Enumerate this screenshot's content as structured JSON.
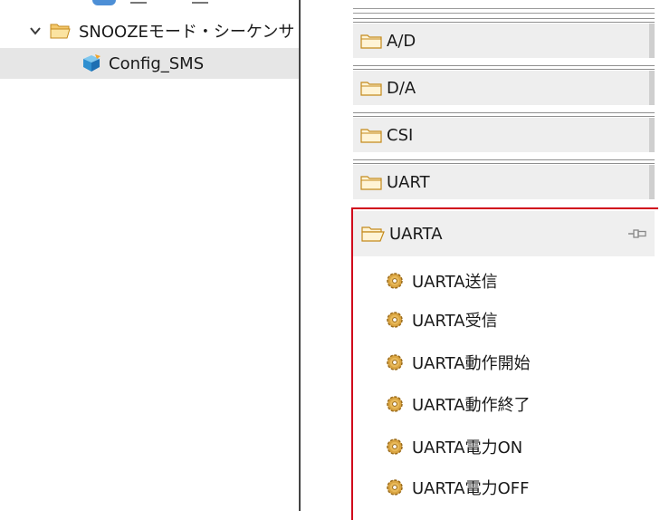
{
  "tree": {
    "parent": {
      "label": "SNOOZEモード・シーケンサ",
      "expanded": true
    },
    "child": {
      "label": "Config_SMS"
    }
  },
  "palette": {
    "drawers": [
      {
        "label": "A/D"
      },
      {
        "label": "D/A"
      },
      {
        "label": "CSI"
      },
      {
        "label": "UART"
      }
    ],
    "open_drawer": {
      "label": "UARTA",
      "items": [
        {
          "label": "UARTA送信"
        },
        {
          "label": "UARTA受信"
        },
        {
          "label": "UARTA動作開始"
        },
        {
          "label": "UARTA動作終了"
        },
        {
          "label": "UARTA電力ON"
        },
        {
          "label": "UARTA電力OFF"
        }
      ]
    }
  },
  "colors": {
    "highlight_border": "#d0021b",
    "selected_row": "#e6e6e6",
    "drawer_bg": "#eeeeee",
    "folder_fill": "#f4c86c",
    "folder_stroke": "#c48a1c",
    "gear_fill": "#d9a441"
  },
  "icons": {
    "tree_expander": "chevron-down-icon",
    "tree_folder": "folder-open-icon",
    "tree_item": "component-cube-icon",
    "drawer_closed": "folder-icon",
    "drawer_open": "folder-open-icon",
    "pin": "pin-icon",
    "tool": "gear-icon"
  }
}
